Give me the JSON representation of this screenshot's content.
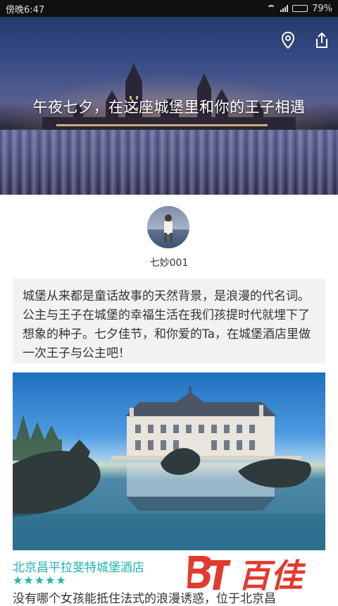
{
  "status_bar": {
    "time": "傍晚6:47",
    "battery": "79%",
    "battery_level": 0.79
  },
  "hero": {
    "title": "午夜七夕，在这座城堡里和你的王子相遇",
    "location_icon": "location-pin-icon",
    "share_icon": "share-icon"
  },
  "author": {
    "name": "七妙001"
  },
  "intro": {
    "text": "城堡从来都是童话故事的天然背景，是浪漫的代名词。公主与王子在城堡的幸福生活在我们孩提时代就埋下了想象的种子。七夕佳节，和你爱的Ta，在城堡酒店里做一次王子与公主吧！"
  },
  "hotel": {
    "name": "北京昌平拉斐特城堡酒店",
    "rating": 5,
    "stars_text": "★★★★★",
    "description": "没有哪个女孩能抵住法式的浪漫诱惑，位于北京昌"
  },
  "watermark": {
    "text": "百佳"
  },
  "colors": {
    "accent": "#20b3b3",
    "watermark": "#e23a2e"
  }
}
